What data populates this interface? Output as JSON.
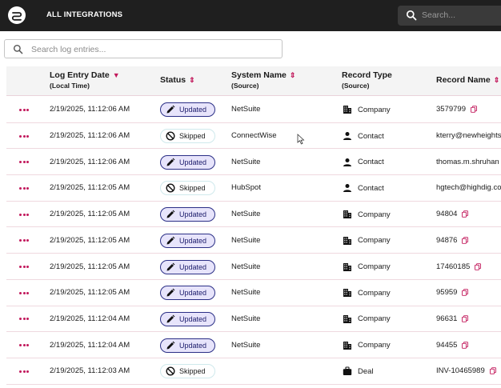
{
  "topbar": {
    "title": "ALL INTEGRATIONS",
    "search_placeholder": "Search..."
  },
  "log_search": {
    "placeholder": "Search log entries..."
  },
  "table": {
    "headers": {
      "date": "Log Entry Date",
      "date_sub": "(Local Time)",
      "status": "Status",
      "system": "System Name",
      "system_sub": "(Source)",
      "record_type": "Record Type",
      "record_type_sub": "(Source)",
      "record_name": "Record Name"
    },
    "rows": [
      {
        "date": "2/19/2025, 11:12:06 AM",
        "status": "Updated",
        "system": "NetSuite",
        "type": "Company",
        "type_icon": "building-icon",
        "name": "3579799"
      },
      {
        "date": "2/19/2025, 11:12:06 AM",
        "status": "Skipped",
        "system": "ConnectWise",
        "type": "Contact",
        "type_icon": "person-icon",
        "name": "kterry@newheights"
      },
      {
        "date": "2/19/2025, 11:12:06 AM",
        "status": "Updated",
        "system": "NetSuite",
        "type": "Contact",
        "type_icon": "person-icon",
        "name": "thomas.m.shruhan"
      },
      {
        "date": "2/19/2025, 11:12:05 AM",
        "status": "Skipped",
        "system": "HubSpot",
        "type": "Contact",
        "type_icon": "person-icon",
        "name": "hgtech@highdig.co"
      },
      {
        "date": "2/19/2025, 11:12:05 AM",
        "status": "Updated",
        "system": "NetSuite",
        "type": "Company",
        "type_icon": "building-icon",
        "name": "94804"
      },
      {
        "date": "2/19/2025, 11:12:05 AM",
        "status": "Updated",
        "system": "NetSuite",
        "type": "Company",
        "type_icon": "building-icon",
        "name": "94876"
      },
      {
        "date": "2/19/2025, 11:12:05 AM",
        "status": "Updated",
        "system": "NetSuite",
        "type": "Company",
        "type_icon": "building-icon",
        "name": "17460185"
      },
      {
        "date": "2/19/2025, 11:12:05 AM",
        "status": "Updated",
        "system": "NetSuite",
        "type": "Company",
        "type_icon": "building-icon",
        "name": "95959"
      },
      {
        "date": "2/19/2025, 11:12:04 AM",
        "status": "Updated",
        "system": "NetSuite",
        "type": "Company",
        "type_icon": "building-icon",
        "name": "96631"
      },
      {
        "date": "2/19/2025, 11:12:04 AM",
        "status": "Updated",
        "system": "NetSuite",
        "type": "Company",
        "type_icon": "building-icon",
        "name": "94455"
      },
      {
        "date": "2/19/2025, 11:12:03 AM",
        "status": "Skipped",
        "system": "",
        "type": "Deal",
        "type_icon": "briefcase-icon",
        "name": "INV-10465989"
      }
    ]
  },
  "colors": {
    "accent": "#c2185b",
    "updated_border": "#2b2f86",
    "updated_bg": "#e7e4fb",
    "topbar": "#1f1f1f"
  }
}
